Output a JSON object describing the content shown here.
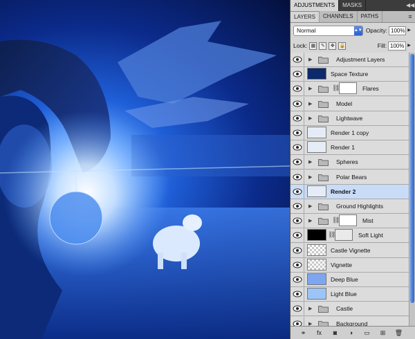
{
  "panel": {
    "top_tabs": [
      "ADJUSTMENTS",
      "MASKS"
    ],
    "sub_tabs": [
      "LAYERS",
      "CHANNELS",
      "PATHS"
    ],
    "blend_mode": "Normal",
    "opacity_label": "Opacity:",
    "opacity_value": "100%",
    "lock_label": "Lock:",
    "fill_label": "Fill:",
    "fill_value": "100%"
  },
  "layers": [
    {
      "name": "Adjustment Layers",
      "kind": "group"
    },
    {
      "name": "Space Texture",
      "kind": "image",
      "thumb": "#0d2a6a"
    },
    {
      "name": "Flares",
      "kind": "group-mask"
    },
    {
      "name": "Model",
      "kind": "group"
    },
    {
      "name": "Lightwave",
      "kind": "group"
    },
    {
      "name": "Render 1 copy",
      "kind": "image",
      "thumb": "#e6ecf5"
    },
    {
      "name": "Render 1",
      "kind": "image",
      "thumb": "#e6ecf5"
    },
    {
      "name": "Spheres",
      "kind": "group"
    },
    {
      "name": "Polar Bears",
      "kind": "group"
    },
    {
      "name": "Render 2",
      "kind": "image",
      "thumb": "#e6ecf5",
      "selected": true
    },
    {
      "name": "Ground Highlights",
      "kind": "group"
    },
    {
      "name": "Mist",
      "kind": "group-mask"
    },
    {
      "name": "Soft Light",
      "kind": "image-mask",
      "thumb": "#000000"
    },
    {
      "name": "Castle Vignette",
      "kind": "checker"
    },
    {
      "name": "Vignette",
      "kind": "checker"
    },
    {
      "name": "Deep Blue",
      "kind": "image",
      "thumb": "#7ea6f0"
    },
    {
      "name": "Light Blue",
      "kind": "image",
      "thumb": "#9cc4f7"
    },
    {
      "name": "Castle",
      "kind": "group"
    },
    {
      "name": "Background",
      "kind": "group"
    }
  ],
  "bottom_icons": [
    "link-icon",
    "fx-icon",
    "mask-icon",
    "adjustment-icon",
    "new-group-icon",
    "new-layer-icon",
    "trash-icon"
  ],
  "bottom_glyphs": [
    "⚭",
    "fx",
    "◙",
    "◑",
    "▭",
    "⊞",
    "🗑"
  ],
  "colors": {
    "accent": "#2d64c9",
    "selected_row": "#c9dcf7",
    "panel_bg": "#d6d6d6"
  }
}
